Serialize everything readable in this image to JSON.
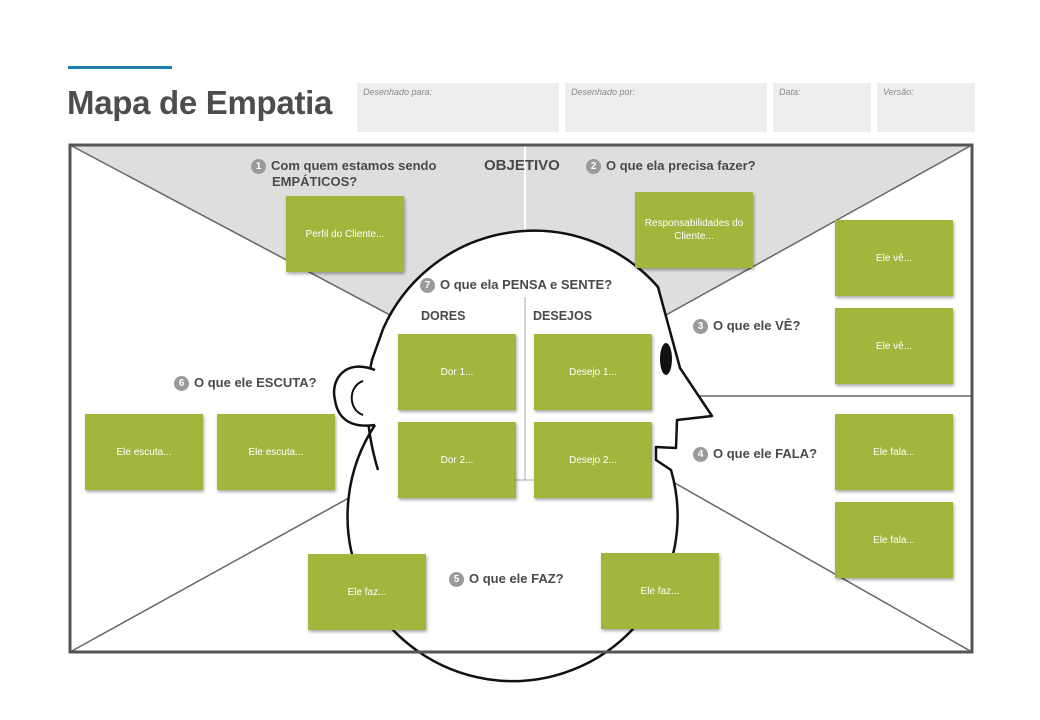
{
  "title": "Mapa de Empatia",
  "accent_color": "#1f7fb5",
  "note_color": "#a2b53d",
  "header_fields": [
    {
      "label": "Desenhado para:"
    },
    {
      "label": "Desenhado por:"
    },
    {
      "label": "Data:"
    },
    {
      "label": "Versão:"
    }
  ],
  "objetivo": "OBJETIVO",
  "sections": {
    "empathy": {
      "number": "1",
      "text_line1": "Com quem estamos sendo",
      "text_line2": "EMPÁTICOS?"
    },
    "need": {
      "number": "2",
      "text": "O que ela precisa fazer?"
    },
    "sees": {
      "number": "3",
      "text": "O que ele VÊ?"
    },
    "says": {
      "number": "4",
      "text": "O que ele FALA?"
    },
    "does": {
      "number": "5",
      "text": "O que ele FAZ?"
    },
    "hears": {
      "number": "6",
      "text": "O que ele ESCUTA?"
    },
    "thinks": {
      "number": "7",
      "text": "O que ela PENSA e SENTE?"
    }
  },
  "dores_label": "DORES",
  "desejos_label": "DESEJOS",
  "notes": {
    "perfil": "Perfil do Cliente...",
    "responsabilidades": "Responsabilidades do Cliente...",
    "ve1": "Ele vê...",
    "ve2": "Ele vê...",
    "dor1": "Dor 1...",
    "dor2": "Dor 2...",
    "desejo1": "Desejo 1...",
    "desejo2": "Desejo 2...",
    "escuta1": "Ele escuta...",
    "escuta2": "Ele escuta...",
    "fala1": "Ele fala...",
    "fala2": "Ele fala...",
    "faz1": "Ele faz...",
    "faz2": "Ele faz..."
  }
}
